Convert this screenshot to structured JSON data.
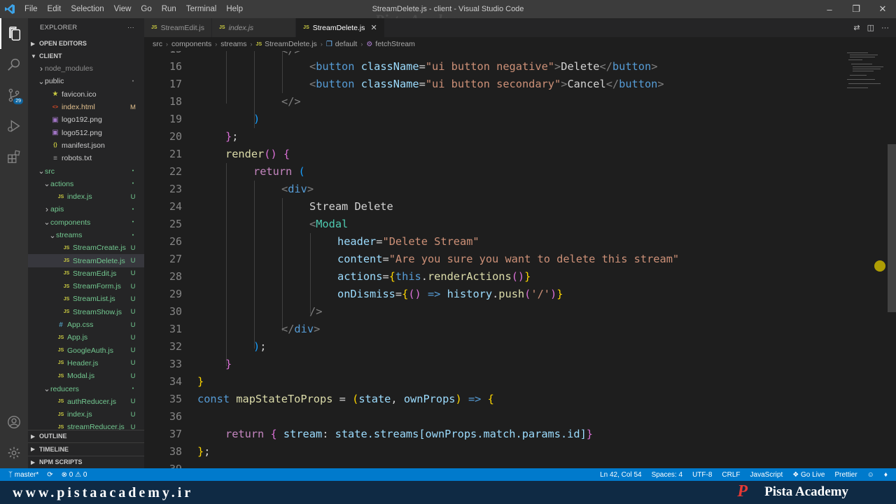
{
  "window": {
    "title": "StreamDelete.js - client - Visual Studio Code",
    "menu": [
      "File",
      "Edit",
      "Selection",
      "View",
      "Go",
      "Run",
      "Terminal",
      "Help"
    ]
  },
  "watermark_top": "Pista Academy",
  "activity": {
    "scm_badge": "29"
  },
  "sidebar": {
    "header": "EXPLORER",
    "more": "···",
    "open_editors": "OPEN EDITORS",
    "root": "CLIENT",
    "items": [
      {
        "label": "node_modules",
        "kind": "folder",
        "status": ""
      },
      {
        "label": "public",
        "kind": "folder-open",
        "status": "•"
      },
      {
        "label": "favicon.ico",
        "kind": "star",
        "status": ""
      },
      {
        "label": "index.html",
        "kind": "html",
        "status": "M"
      },
      {
        "label": "logo192.png",
        "kind": "img",
        "status": ""
      },
      {
        "label": "logo512.png",
        "kind": "img",
        "status": ""
      },
      {
        "label": "manifest.json",
        "kind": "json",
        "status": ""
      },
      {
        "label": "robots.txt",
        "kind": "txt",
        "status": ""
      },
      {
        "label": "src",
        "kind": "folder-open",
        "status": "•"
      },
      {
        "label": "actions",
        "kind": "folder-open",
        "status": "•"
      },
      {
        "label": "index.js",
        "kind": "js",
        "status": "U"
      },
      {
        "label": "apis",
        "kind": "folder",
        "status": "•"
      },
      {
        "label": "components",
        "kind": "folder-open",
        "status": "•"
      },
      {
        "label": "streams",
        "kind": "folder-open",
        "status": "•"
      },
      {
        "label": "StreamCreate.js",
        "kind": "js",
        "status": "U"
      },
      {
        "label": "StreamDelete.js",
        "kind": "js",
        "status": "U"
      },
      {
        "label": "StreamEdit.js",
        "kind": "js",
        "status": "U"
      },
      {
        "label": "StreamForm.js",
        "kind": "js",
        "status": "U"
      },
      {
        "label": "StreamList.js",
        "kind": "js",
        "status": "U"
      },
      {
        "label": "StreamShow.js",
        "kind": "js",
        "status": "U"
      },
      {
        "label": "App.css",
        "kind": "css",
        "status": "U"
      },
      {
        "label": "App.js",
        "kind": "js",
        "status": "U"
      },
      {
        "label": "GoogleAuth.js",
        "kind": "js",
        "status": "U"
      },
      {
        "label": "Header.js",
        "kind": "js",
        "status": "U"
      },
      {
        "label": "Modal.js",
        "kind": "js",
        "status": "U"
      },
      {
        "label": "reducers",
        "kind": "folder-open",
        "status": "•"
      },
      {
        "label": "authReducer.js",
        "kind": "js",
        "status": "U"
      },
      {
        "label": "index.js",
        "kind": "js",
        "status": "U"
      },
      {
        "label": "streamReducer.js",
        "kind": "js",
        "status": "U"
      }
    ],
    "outline": "OUTLINE",
    "timeline": "TIMELINE",
    "npm_scripts": "NPM SCRIPTS"
  },
  "tabs": [
    {
      "label": "StreamEdit.js",
      "active": false
    },
    {
      "label": "index.js",
      "active": false
    },
    {
      "label": "StreamDelete.js",
      "active": true
    }
  ],
  "breadcrumb": [
    "src",
    "components",
    "streams",
    "StreamDelete.js",
    "default",
    "fetchStream"
  ],
  "code_lines": [
    {
      "n": "15",
      "partial": true
    },
    {
      "n": "16"
    },
    {
      "n": "17"
    },
    {
      "n": "18"
    },
    {
      "n": "19"
    },
    {
      "n": "20"
    },
    {
      "n": "21"
    },
    {
      "n": "22"
    },
    {
      "n": "23"
    },
    {
      "n": "24"
    },
    {
      "n": "25"
    },
    {
      "n": "26"
    },
    {
      "n": "27"
    },
    {
      "n": "28"
    },
    {
      "n": "29"
    },
    {
      "n": "30"
    },
    {
      "n": "31"
    },
    {
      "n": "32"
    },
    {
      "n": "33"
    },
    {
      "n": "34"
    },
    {
      "n": "35"
    },
    {
      "n": "36"
    },
    {
      "n": "37"
    },
    {
      "n": "38"
    },
    {
      "n": "39",
      "partial": true
    }
  ],
  "code": {
    "l16": {
      "tag": "button",
      "attr": "className",
      "val": "\"ui button negative\"",
      "text": "Delete"
    },
    "l17": {
      "tag": "button",
      "attr": "className",
      "val": "\"ui button secondary\"",
      "text": "Cancel"
    },
    "l21": {
      "fn": "render"
    },
    "l22": {
      "kw": "return"
    },
    "l23": {
      "tag": "div"
    },
    "l24": {
      "text": "Stream Delete"
    },
    "l25": {
      "tag": "Modal"
    },
    "l26": {
      "attr": "header",
      "val": "\"Delete Stream\""
    },
    "l27": {
      "attr": "content",
      "val": "\"Are you sure you want to delete this stream\""
    },
    "l28": {
      "attr": "actions",
      "this": "this",
      "method": "renderActions"
    },
    "l29": {
      "attr": "onDismiss",
      "obj": "history",
      "method": "push",
      "arg": "'/'"
    },
    "l35": {
      "kw": "const",
      "name": "mapStateToProps",
      "p1": "state",
      "p2": "ownProps"
    },
    "l37": {
      "kw": "return",
      "key": "stream",
      "expr": "state.streams[ownProps.match.params.id]"
    }
  },
  "statusbar": {
    "branch": "master*",
    "errors": "0",
    "warnings": "0",
    "position": "Ln 42, Col 54",
    "spaces": "Spaces: 4",
    "encoding": "UTF-8",
    "eol": "CRLF",
    "language": "JavaScript",
    "golive": "Go Live",
    "prettier": "Prettier"
  },
  "footer": {
    "url": "www.pistaacademy.ir",
    "brand": "Pista Academy",
    "logo": "P"
  },
  "colors": {
    "accent": "#007acc",
    "editor_bg": "#1e1e1e",
    "sidebar_bg": "#252526",
    "untracked": "#73c991",
    "modified": "#e2c08d"
  }
}
